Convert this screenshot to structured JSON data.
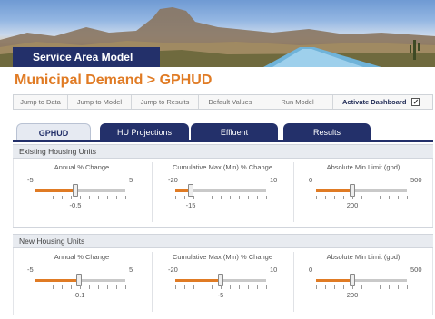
{
  "banner": {
    "title": "Service Area Model"
  },
  "page": {
    "title": "Municipal Demand > GPHUD"
  },
  "toolbar": {
    "buttons": [
      "Jump to Data",
      "Jump to Model",
      "Jump to Results",
      "Default Values",
      "Run Model"
    ],
    "activate_label": "Activate Dashboard",
    "activate_checked": true
  },
  "tabs": [
    {
      "label": "GPHUD",
      "active": true
    },
    {
      "label": "HU Projections",
      "active": false
    },
    {
      "label": "Effluent",
      "active": false
    },
    {
      "label": "Results",
      "active": false
    }
  ],
  "colors": {
    "accent": "#e07b24",
    "brand": "#23306a",
    "track": "#c9c9c9"
  },
  "sections": [
    {
      "title": "Existing Housing Units",
      "sliders": [
        {
          "label": "Annual % Change",
          "min": "-5",
          "max": "5",
          "value": "-0.5",
          "fraction": 0.45
        },
        {
          "label": "Cumulative Max (Min) % Change",
          "min": "-20",
          "max": "10",
          "value": "-15",
          "fraction": 0.1667
        },
        {
          "label": "Absolute Min Limit (gpd)",
          "min": "0",
          "max": "500",
          "value": "200",
          "fraction": 0.4
        }
      ]
    },
    {
      "title": "New Housing Units",
      "sliders": [
        {
          "label": "Annual % Change",
          "min": "-5",
          "max": "5",
          "value": "-0.1",
          "fraction": 0.49
        },
        {
          "label": "Cumulative Max (Min) % Change",
          "min": "-20",
          "max": "10",
          "value": "-5",
          "fraction": 0.5
        },
        {
          "label": "Absolute Min Limit (gpd)",
          "min": "0",
          "max": "500",
          "value": "200",
          "fraction": 0.4
        }
      ]
    }
  ]
}
